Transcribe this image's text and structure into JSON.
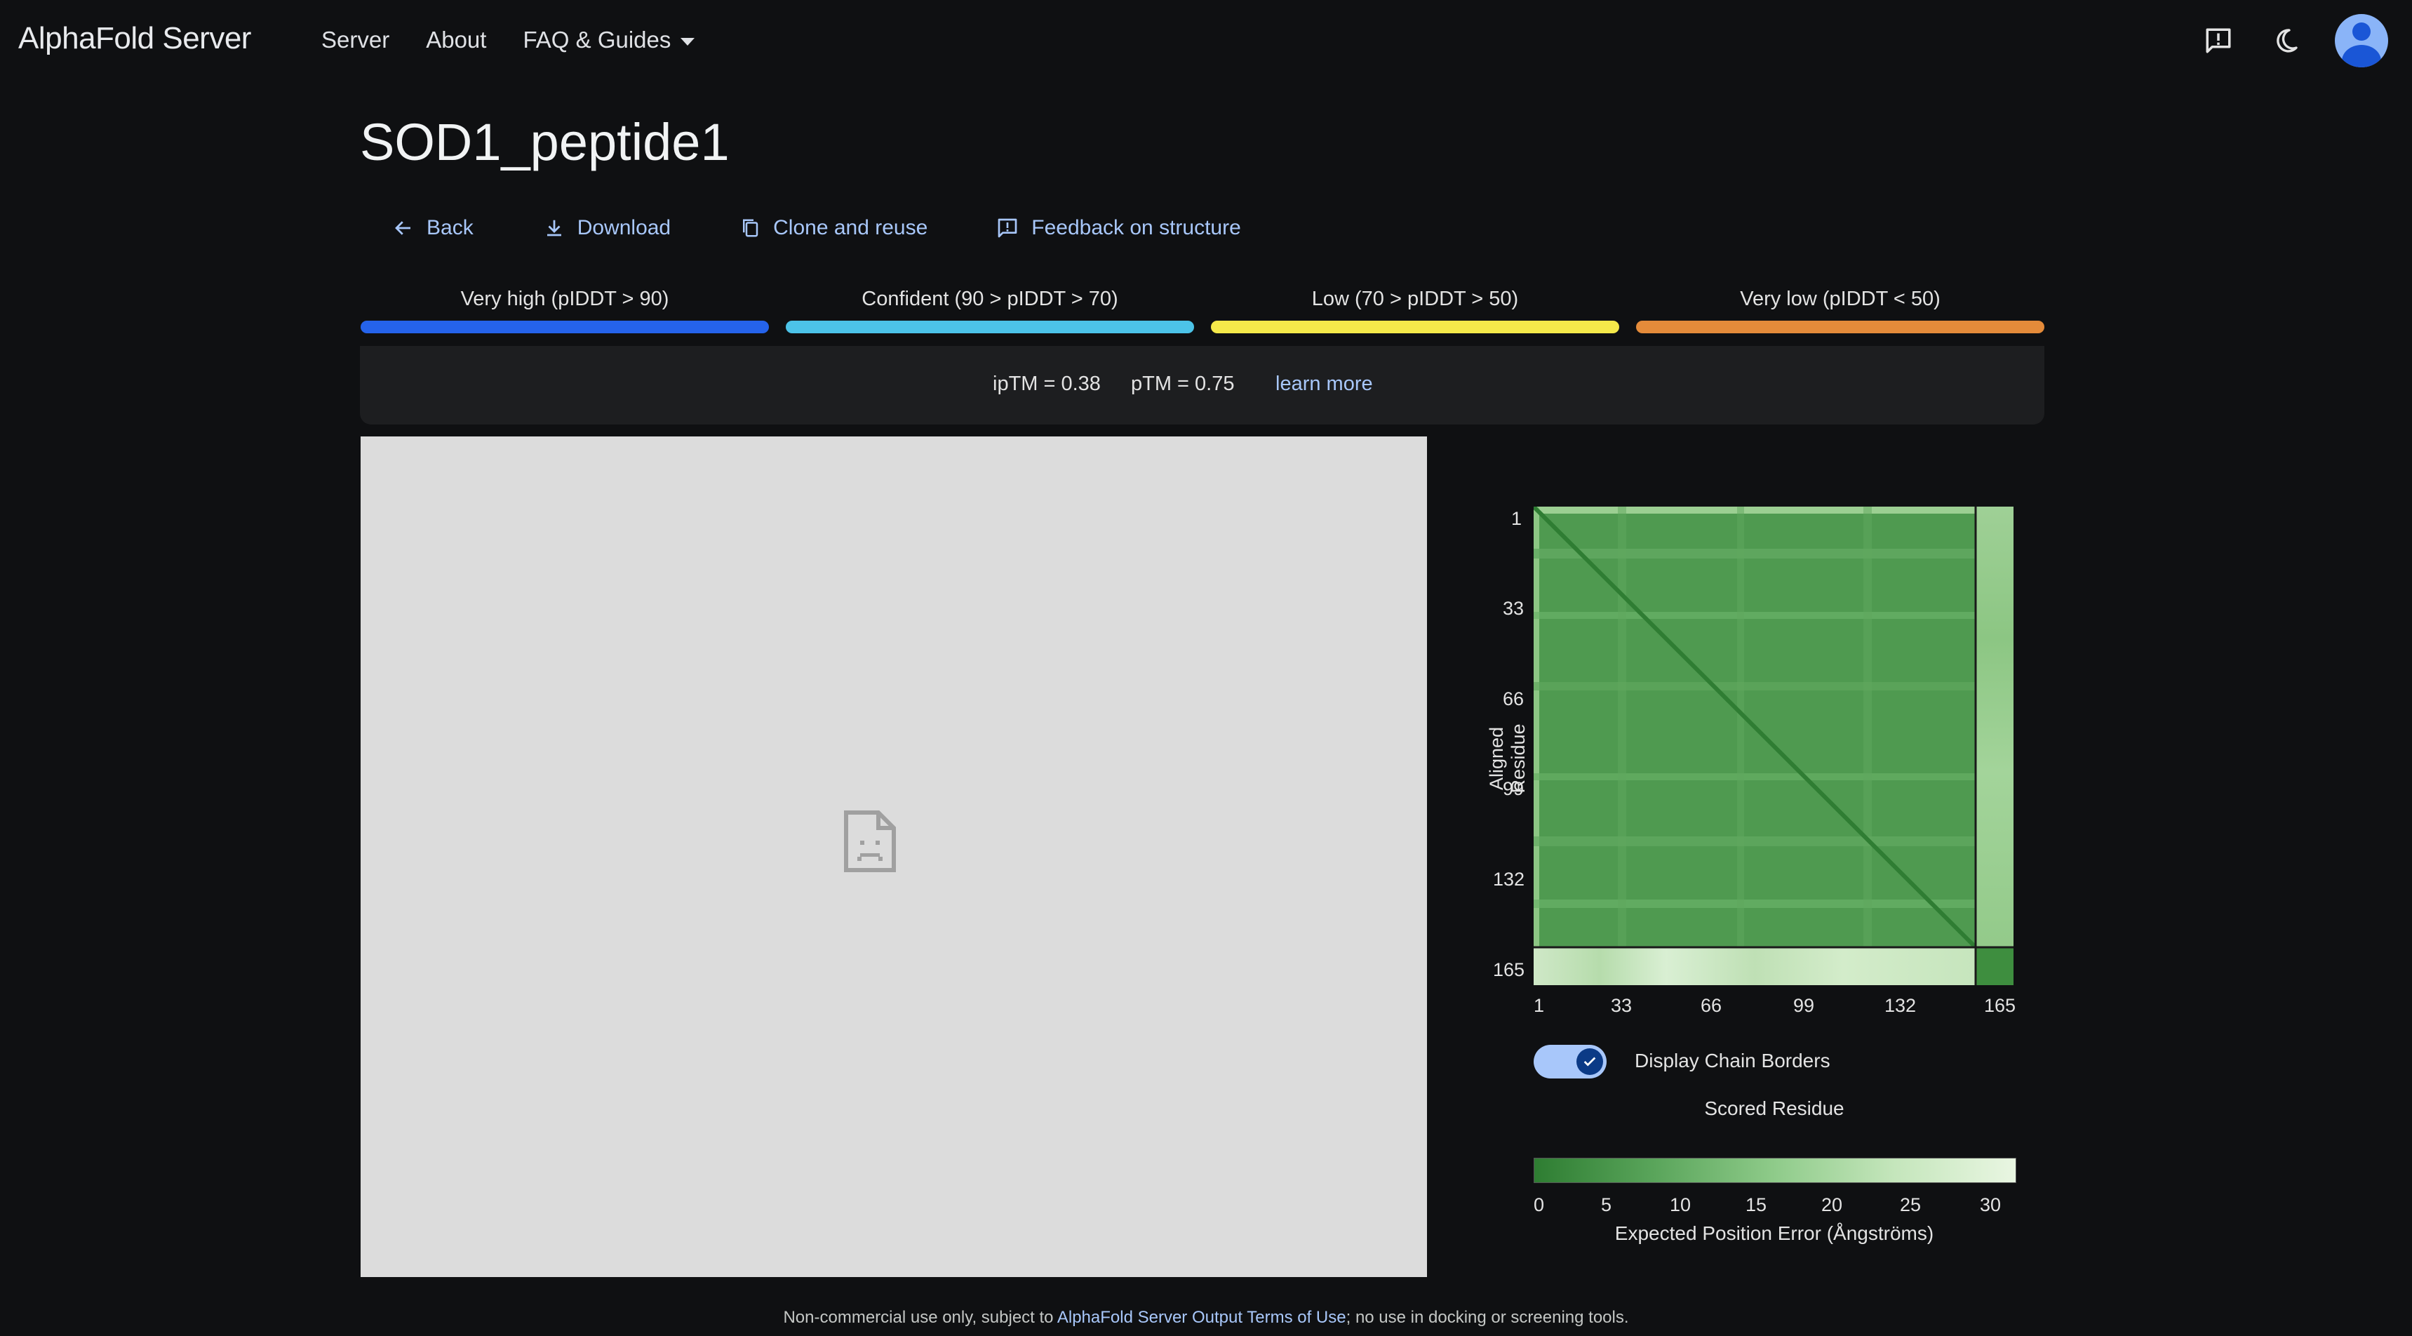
{
  "header": {
    "brand": "AlphaFold Server",
    "nav": [
      "Server",
      "About",
      "FAQ & Guides"
    ]
  },
  "icons": {
    "feedback": "feedback-icon",
    "theme": "dark-mode-moon-icon",
    "avatar": "account-avatar"
  },
  "page": {
    "title": "SOD1_peptide1"
  },
  "actions": {
    "back": "Back",
    "download": "Download",
    "clone": "Clone and reuse",
    "feedback": "Feedback on structure"
  },
  "plddt_legend": [
    {
      "label": "Very high (pIDDT > 90)",
      "color": "#2563eb"
    },
    {
      "label": "Confident (90 > pIDDT > 70)",
      "color": "#4cc3e8"
    },
    {
      "label": "Low (70 > pIDDT > 50)",
      "color": "#f5e94a"
    },
    {
      "label": "Very low (pIDDT < 50)",
      "color": "#e48b3a"
    }
  ],
  "scores": {
    "iptm": "ipTM = 0.38",
    "ptm": "pTM = 0.75",
    "learn_more": "learn more"
  },
  "pae": {
    "y_axis_title": "Aligned Residue",
    "x_axis_title": "Scored Residue",
    "ticks": [
      "1",
      "33",
      "66",
      "99",
      "132",
      "165"
    ],
    "toggle_label": "Display Chain Borders",
    "toggle_on": true,
    "colorbar_ticks": [
      "0",
      "5",
      "10",
      "15",
      "20",
      "25",
      "30"
    ],
    "colorbar_title": "Expected Position Error (Ångströms)"
  },
  "footer": {
    "prefix": "Non-commercial use only, subject to ",
    "link": "AlphaFold Server Output Terms of Use",
    "suffix": "; no use in docking or screening tools."
  }
}
